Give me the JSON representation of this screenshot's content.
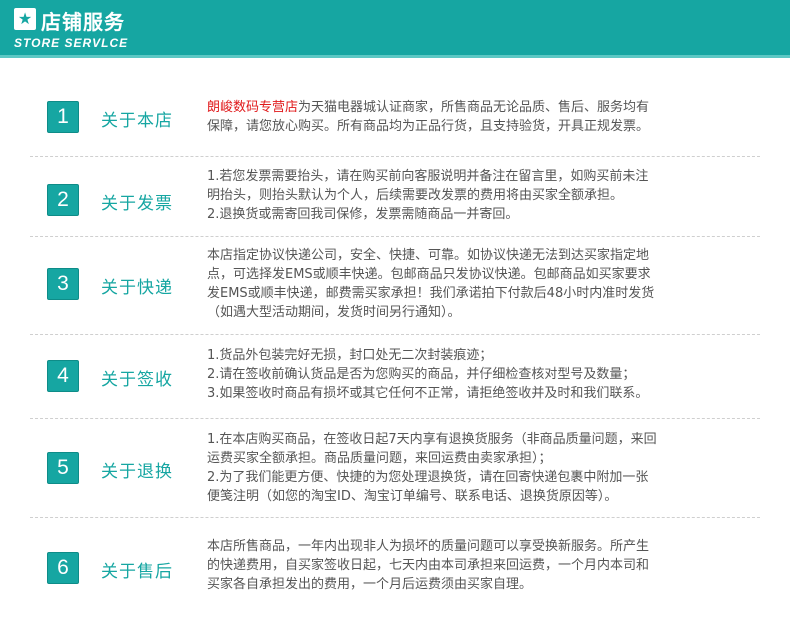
{
  "header": {
    "title": "店铺服务",
    "subtitle": "STORE SERVLCE",
    "logo_icon": "star-icon",
    "accent_color": "#16a6a2"
  },
  "sections": [
    {
      "number": "1",
      "label": "关于本店",
      "brand": "朗峻数码专营店",
      "lines": [
        "为天猫电器城认证商家，所售商品无论品质、售后、服务均有",
        "保障，请您放心购买。所有商品均为正品行货，且支持验货，开具正规发票。"
      ]
    },
    {
      "number": "2",
      "label": "关于发票",
      "lines": [
        "1.若您发票需要抬头，请在购买前向客服说明并备注在留言里，如购买前未注",
        "明抬头，则抬头默认为个人，后续需要改发票的费用将由买家全额承担。",
        "2.退换货或需寄回我司保修，发票需随商品一并寄回。"
      ]
    },
    {
      "number": "3",
      "label": "关于快递",
      "lines": [
        "本店指定协议快递公司，安全、快捷、可靠。如协议快递无法到达买家指定地",
        "点，可选择发EMS或顺丰快递。包邮商品只发协议快递。包邮商品如买家要求",
        "发EMS或顺丰快递，邮费需买家承担！我们承诺拍下付款后48小时内准时发货",
        "（如遇大型活动期间，发货时间另行通知）。"
      ]
    },
    {
      "number": "4",
      "label": "关于签收",
      "lines": [
        "1.货品外包装完好无损，封口处无二次封装痕迹；",
        "2.请在签收前确认货品是否为您购买的商品，并仔细检查核对型号及数量；",
        "3.如果签收时商品有损坏或其它任何不正常，请拒绝签收并及时和我们联系。"
      ]
    },
    {
      "number": "5",
      "label": "关于退换",
      "lines": [
        "1.在本店购买商品，在签收日起7天内享有退换货服务（非商品质量问题，来回",
        "运费买家全额承担。商品质量问题，来回运费由卖家承担）；",
        "2.为了我们能更方便、快捷的为您处理退换货，请在回寄快递包裹中附加一张",
        "便笺注明（如您的淘宝ID、淘宝订单编号、联系电话、退换货原因等）。"
      ]
    },
    {
      "number": "6",
      "label": "关于售后",
      "lines": [
        "本店所售商品，一年内出现非人为损坏的质量问题可以享受换新服务。所产生",
        "的快递费用，自买家签收日起，七天内由本司承担来回运费，一个月内本司和",
        "买家各自承担发出的费用，一个月后运费须由买家自理。"
      ]
    }
  ]
}
